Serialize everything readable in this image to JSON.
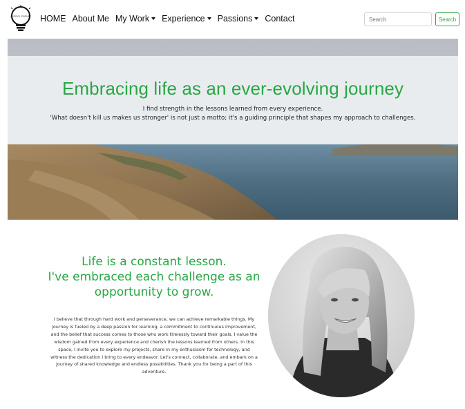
{
  "brand": {
    "logo_icon": "lightbulb-logo-icon",
    "logo_text": "ALISON'S JOURNEY"
  },
  "nav": {
    "items": [
      {
        "label": "HOME",
        "dropdown": false
      },
      {
        "label": "About Me",
        "dropdown": false
      },
      {
        "label": "My Work",
        "dropdown": true
      },
      {
        "label": "Experience",
        "dropdown": true
      },
      {
        "label": "Passions",
        "dropdown": true
      },
      {
        "label": "Contact",
        "dropdown": false
      }
    ]
  },
  "search": {
    "placeholder": "Search",
    "button_label": "Search"
  },
  "hero": {
    "title": "Embracing life as an ever-evolving journey",
    "lead_line1": "I find strength in the lessons learned from every experience.",
    "lead_line2": "'What doesn't kill us makes us stronger' is not just a motto; it's a guiding principle that shapes my approach to challenges."
  },
  "about": {
    "heading_line1": "Life is a constant lesson.",
    "heading_line2": "I've embraced each challenge as an",
    "heading_line3": "opportunity to grow.",
    "paragraph": "I believe that through hard work and perseverance, we can achieve remarkable things. My journey is fueled by a deep passion for learning, a commitment to continuous improvement, and the belief that success comes to those who work tirelessly toward their goals. I value the wisdom gained from every experience and cherish the lessons learned from others. In this space, I invite you to explore my projects, share in my enthusiasm for technology, and witness the dedication I bring to every endeavor. Let's connect, collaborate, and embark on a journey of shared knowledge and endless possibilities. Thank you for being a part of this adventure."
  },
  "colors": {
    "accent": "#28a745",
    "jumbotron": "#e9ecef",
    "text": "#212529"
  }
}
